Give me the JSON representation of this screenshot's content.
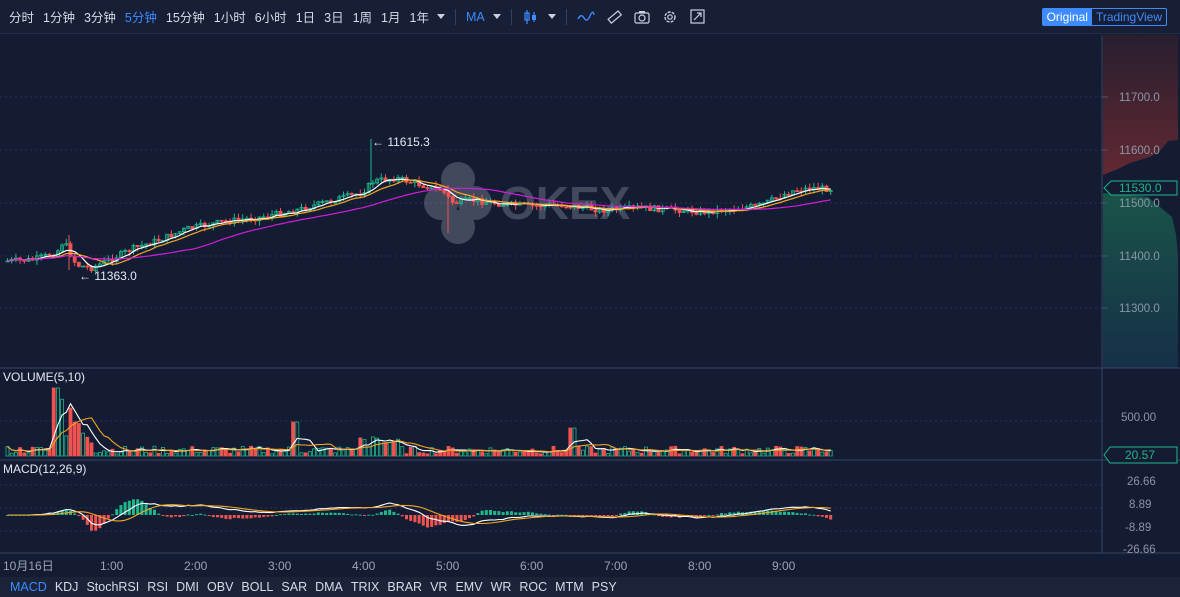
{
  "toolbar": {
    "intervals": [
      "分时",
      "1分钟",
      "3分钟",
      "5分钟",
      "15分钟",
      "1小时",
      "6小时",
      "1日",
      "3日",
      "1周",
      "1月",
      "1年"
    ],
    "active_interval": "5分钟",
    "indicator_label": "MA",
    "view_original": "Original",
    "view_tradingview": "TradingView"
  },
  "watermark": "OKEX",
  "main": {
    "price_ticks": [
      "11700.0",
      "11600.0",
      "11500.0",
      "11400.0",
      "11300.0"
    ],
    "current_price": "11530.0",
    "high_label": "← 11615.3",
    "low_label": "← 11363.0"
  },
  "volume": {
    "title": "VOLUME(5,10)",
    "ticks": [
      "500.00"
    ],
    "current": "20.57"
  },
  "macd": {
    "title": "MACD(12,26,9)",
    "ticks": [
      "26.66",
      "8.89",
      "-8.89",
      "-26.66"
    ]
  },
  "time_axis": [
    "10月16日",
    "1:00",
    "2:00",
    "3:00",
    "4:00",
    "5:00",
    "6:00",
    "7:00",
    "8:00",
    "9:00"
  ],
  "indicator_tabs": [
    "MACD",
    "KDJ",
    "StochRSI",
    "RSI",
    "DMI",
    "OBV",
    "BOLL",
    "SAR",
    "DMA",
    "TRIX",
    "BRAR",
    "VR",
    "EMV",
    "WR",
    "ROC",
    "MTM",
    "PSY"
  ],
  "active_indicator": "MACD",
  "colors": {
    "up": "#1fb68a",
    "down": "#ef5350",
    "ma5": "#ffffff",
    "ma10": "#f5a623",
    "ma30": "#d21ed8",
    "accent": "#3d8bff",
    "background": "#131c33"
  }
}
